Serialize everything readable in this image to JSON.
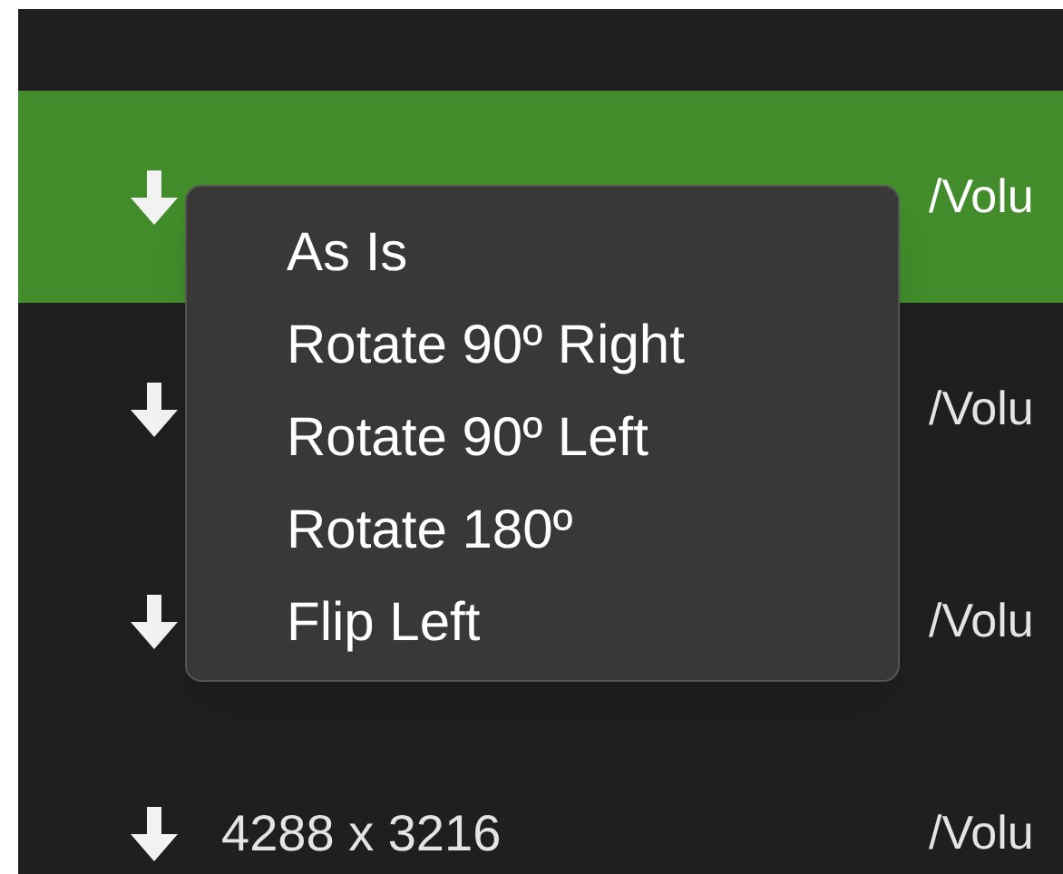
{
  "rows": [
    {
      "selected": true,
      "path": "/Volu"
    },
    {
      "selected": false,
      "path": "/Volu"
    },
    {
      "selected": false,
      "path": "/Volu"
    },
    {
      "selected": false,
      "dimensions": "4288 x 3216",
      "path": "/Volu"
    }
  ],
  "context_menu": {
    "items": [
      "As Is",
      "Rotate 90º Right",
      "Rotate 90º Left",
      "Rotate 180º",
      "Flip Left"
    ]
  }
}
